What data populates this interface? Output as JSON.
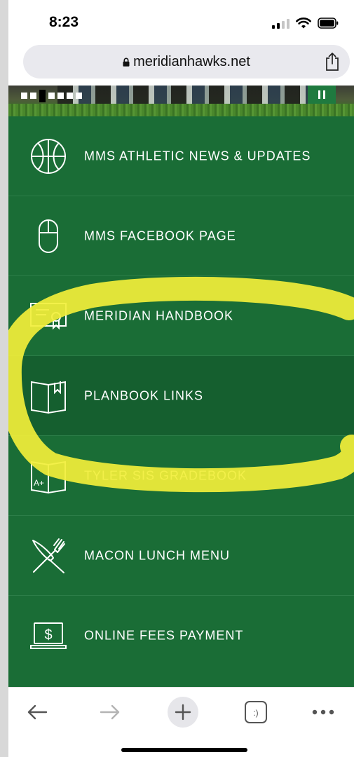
{
  "status_bar": {
    "time": "8:23",
    "icons": [
      "signal-icon",
      "wifi-icon",
      "battery-icon"
    ]
  },
  "browser": {
    "url": "meridianhawks.net",
    "icons": [
      "lock-icon",
      "share-icon"
    ]
  },
  "banner": {
    "pause_icon": "pause-icon"
  },
  "menu": {
    "items": [
      {
        "label": "MMS ATHLETIC NEWS & UPDATES",
        "icon": "basketball-icon"
      },
      {
        "label": "MMS FACEBOOK PAGE",
        "icon": "mouse-icon"
      },
      {
        "label": "MERIDIAN HANDBOOK",
        "icon": "certificate-icon"
      },
      {
        "label": "PLANBOOK LINKS",
        "icon": "book-icon"
      },
      {
        "label": "TYLER SIS GRADEBOOK",
        "icon": "gradebook-icon",
        "icon_text": "A+"
      },
      {
        "label": "MACON LUNCH MENU",
        "icon": "fork-knife-icon"
      },
      {
        "label": "ONLINE FEES PAYMENT",
        "icon": "laptop-dollar-icon",
        "icon_text": "$"
      }
    ]
  },
  "toolbar": {
    "icons": [
      "back-arrow-icon",
      "forward-arrow-icon",
      "new-tab-icon",
      "tabs-icon",
      "more-icon"
    ],
    "tabs_icon_text": ":)"
  },
  "colors": {
    "menu_green": "#1a6d36",
    "menu_active": "#155f2f",
    "highlight_yellow": "#f2ef3a"
  }
}
